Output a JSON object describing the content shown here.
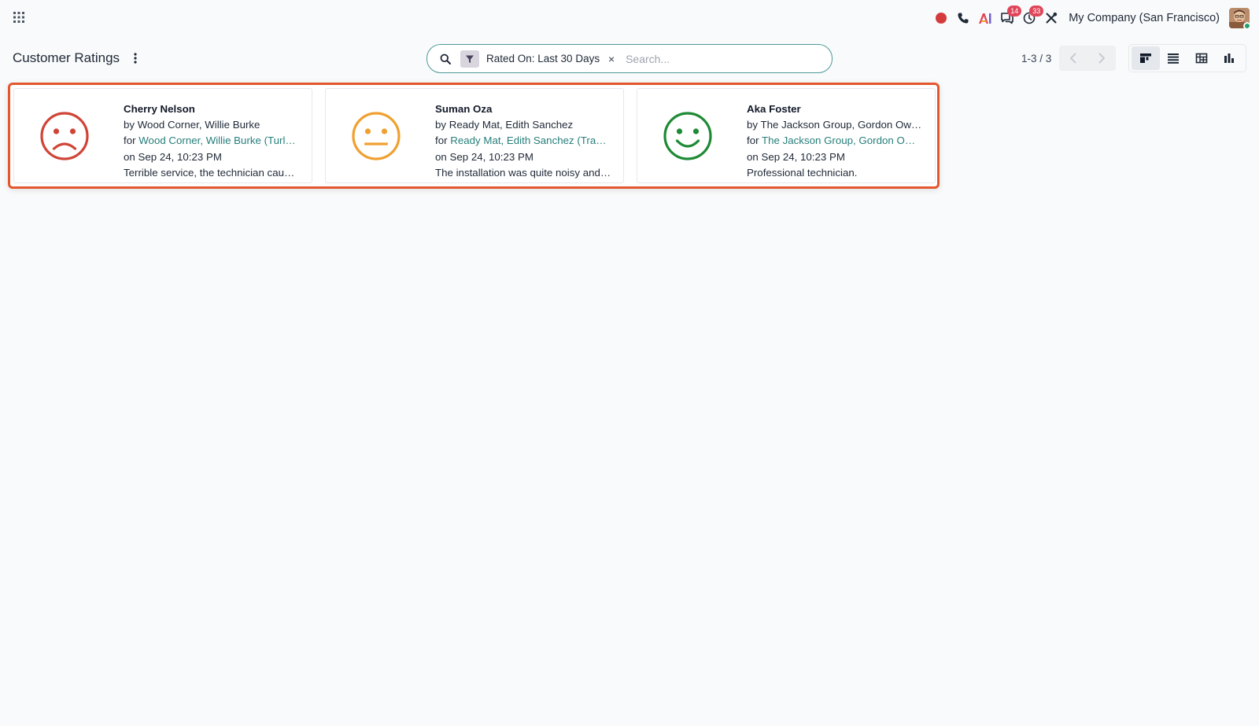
{
  "navbar": {
    "company": "My Company (San Francisco)",
    "messages_badge": "14",
    "activities_badge": "33",
    "record_color": "#d63b3b"
  },
  "control_panel": {
    "title": "Customer Ratings",
    "search": {
      "facet_label": "Rated On: Last 30 Days",
      "facet_remove": "×",
      "placeholder": "Search...",
      "value": ""
    },
    "pager": {
      "value": "1-3 / 3"
    },
    "views": [
      "kanban",
      "list",
      "pivot",
      "graph"
    ],
    "active_view": "kanban"
  },
  "cards": [
    {
      "name": "Cherry Nelson",
      "by_prefix": "by",
      "by": "Wood Corner, Willie Burke",
      "for_prefix": "for",
      "for_link": "Wood Corner, Willie Burke (Turl…",
      "date": "on Sep 24, 10:23 PM",
      "comment": "Terrible service, the technician cau…",
      "rating": "unhappy",
      "face_color": "#d04437"
    },
    {
      "name": "Suman Oza",
      "by_prefix": "by",
      "by": "Ready Mat, Edith Sanchez",
      "for_prefix": "for",
      "for_link": "Ready Mat, Edith Sanchez (Tra…",
      "date": "on Sep 24, 10:23 PM",
      "comment": "The installation was quite noisy and…",
      "rating": "neutral",
      "face_color": "#f0a030"
    },
    {
      "name": "Aka Foster",
      "by_prefix": "by",
      "by": "The Jackson Group, Gordon Ow…",
      "for_prefix": "for",
      "for_link": "The Jackson Group, Gordon O…",
      "date": "on Sep 24, 10:23 PM",
      "comment": "Professional technician.",
      "rating": "happy",
      "face_color": "#1e8a35"
    }
  ],
  "colors": {
    "link": "#257e7a",
    "highlight_border": "#e4572e",
    "search_border": "#4e9996",
    "badge": "#e0465a"
  }
}
